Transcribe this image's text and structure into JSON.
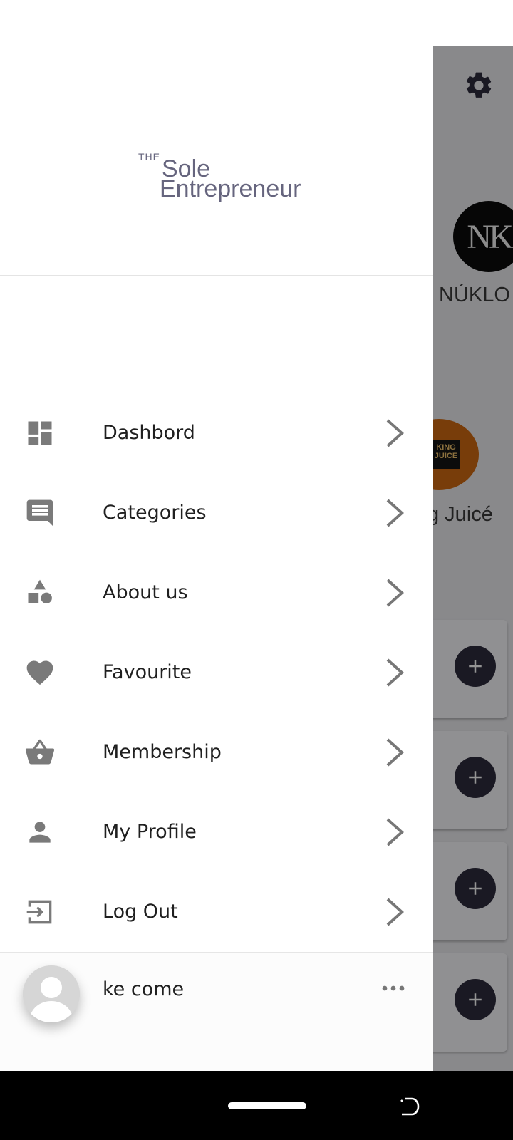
{
  "background": {
    "brands": [
      {
        "logo_text": "NK",
        "name": "NÚKLO"
      },
      {
        "logo_text": "KING JUICE",
        "name": "g Juicé"
      }
    ],
    "card_count": 4
  },
  "drawer": {
    "logo": {
      "the": "THE",
      "line1": "Sole",
      "line2": "Entrepreneur"
    },
    "menu": [
      {
        "label": "Dashbord",
        "icon": "dashboard-icon"
      },
      {
        "label": "Categories",
        "icon": "chat-icon"
      },
      {
        "label": "About us",
        "icon": "shapes-icon"
      },
      {
        "label": "Favourite",
        "icon": "heart-icon"
      },
      {
        "label": "Membership",
        "icon": "basket-icon"
      },
      {
        "label": "My Profile",
        "icon": "person-icon"
      },
      {
        "label": "Log Out",
        "icon": "logout-icon"
      }
    ],
    "user": {
      "name": "ke come"
    }
  },
  "colors": {
    "accent": "#2d2b3d",
    "icon_gray": "#7a7a7a",
    "logo_text": "#66657e"
  }
}
